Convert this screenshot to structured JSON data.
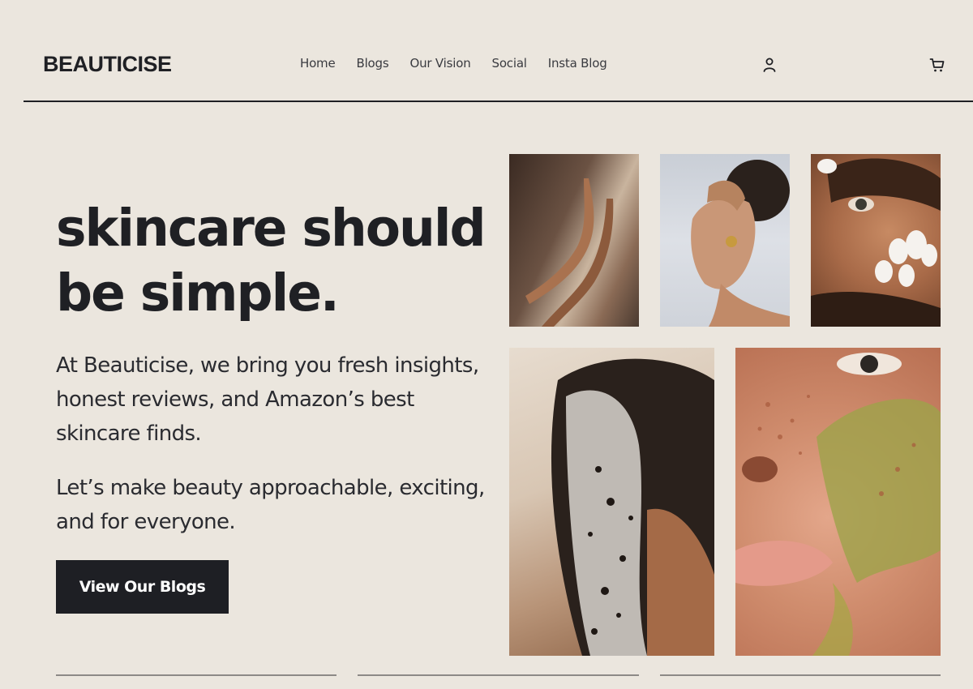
{
  "brand": {
    "name": "BEAUTICISE"
  },
  "nav": {
    "items": [
      {
        "label": "Home"
      },
      {
        "label": "Blogs"
      },
      {
        "label": "Our Vision"
      },
      {
        "label": "Social"
      },
      {
        "label": "Insta Blog"
      }
    ]
  },
  "header_icons": {
    "user": "user-icon",
    "cart": "cart-icon"
  },
  "hero": {
    "title_line1": "skincare should",
    "title_line2": "be simple.",
    "paragraph1": "At Beauticise, we bring you fresh insights, honest reviews, and Amazon’s best skincare finds.",
    "paragraph2": "Let’s make beauty approachable, exciting, and for everyone.",
    "cta_label": "View Our Blogs"
  },
  "colors": {
    "background": "#ebe6de",
    "text": "#1f2024",
    "button": "#1e1f24",
    "button_text": "#ffffff"
  }
}
